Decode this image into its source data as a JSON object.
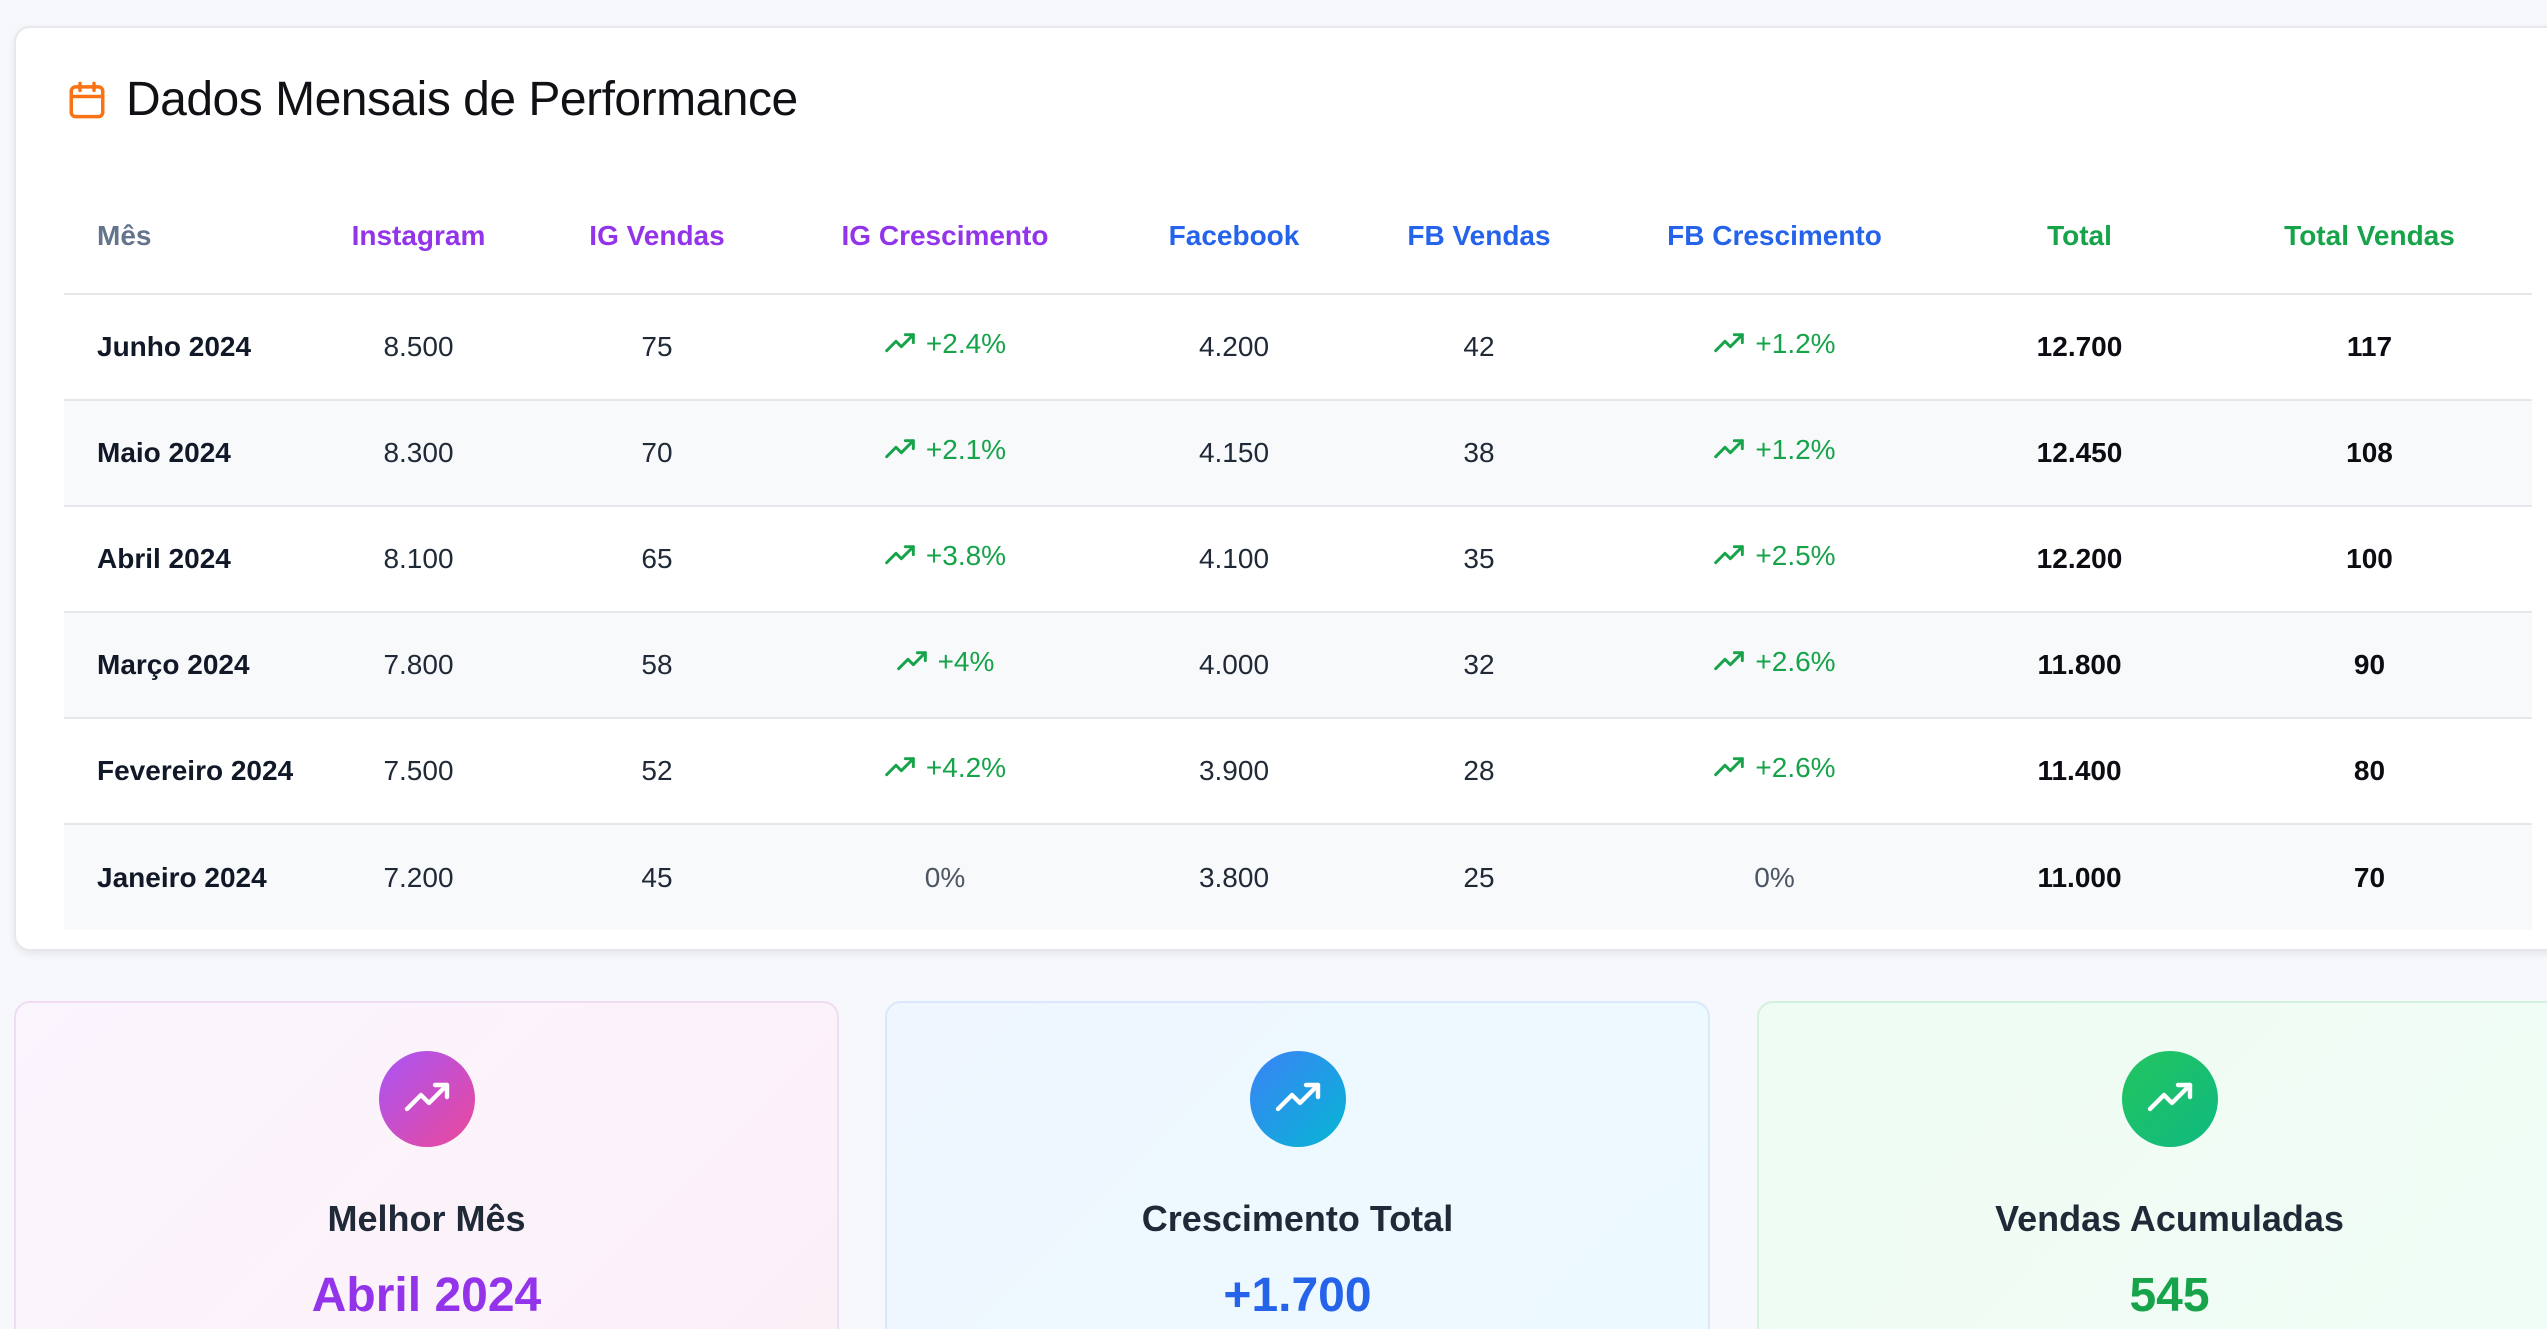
{
  "performance": {
    "title": "Dados Mensais de Performance",
    "icon": "calendar-icon",
    "accent_color": "#f97316",
    "columns": {
      "month": "Mês",
      "instagram": "Instagram",
      "ig_sales": "IG Vendas",
      "ig_growth": "IG Crescimento",
      "facebook": "Facebook",
      "fb_sales": "FB Vendas",
      "fb_growth": "FB Crescimento",
      "total": "Total",
      "total_sales": "Total Vendas"
    },
    "rows": [
      {
        "month": "Junho 2024",
        "instagram": "8.500",
        "ig_sales": "75",
        "ig_growth": "+2.4%",
        "facebook": "4.200",
        "fb_sales": "42",
        "fb_growth": "+1.2%",
        "total": "12.700",
        "total_sales": "117"
      },
      {
        "month": "Maio 2024",
        "instagram": "8.300",
        "ig_sales": "70",
        "ig_growth": "+2.1%",
        "facebook": "4.150",
        "fb_sales": "38",
        "fb_growth": "+1.2%",
        "total": "12.450",
        "total_sales": "108"
      },
      {
        "month": "Abril 2024",
        "instagram": "8.100",
        "ig_sales": "65",
        "ig_growth": "+3.8%",
        "facebook": "4.100",
        "fb_sales": "35",
        "fb_growth": "+2.5%",
        "total": "12.200",
        "total_sales": "100"
      },
      {
        "month": "Março 2024",
        "instagram": "7.800",
        "ig_sales": "58",
        "ig_growth": "+4%",
        "facebook": "4.000",
        "fb_sales": "32",
        "fb_growth": "+2.6%",
        "total": "11.800",
        "total_sales": "90"
      },
      {
        "month": "Fevereiro 2024",
        "instagram": "7.500",
        "ig_sales": "52",
        "ig_growth": "+4.2%",
        "facebook": "3.900",
        "fb_sales": "28",
        "fb_growth": "+2.6%",
        "total": "11.400",
        "total_sales": "80"
      },
      {
        "month": "Janeiro 2024",
        "instagram": "7.200",
        "ig_sales": "45",
        "ig_growth": "0%",
        "facebook": "3.800",
        "fb_sales": "25",
        "fb_growth": "0%",
        "total": "11.000",
        "total_sales": "70"
      }
    ],
    "colors": {
      "instagram": "#9333ea",
      "facebook": "#2563eb",
      "total": "#16a34a",
      "growth": "#16a34a"
    }
  },
  "summary": {
    "best_month": {
      "label": "Melhor Mês",
      "value": "Abril 2024",
      "icon": "trending-up-icon"
    },
    "total_growth": {
      "label": "Crescimento Total",
      "value": "+1.700",
      "icon": "trending-up-icon"
    },
    "accumulated_sales": {
      "label": "Vendas Acumuladas",
      "value": "545",
      "icon": "trending-up-icon"
    }
  }
}
